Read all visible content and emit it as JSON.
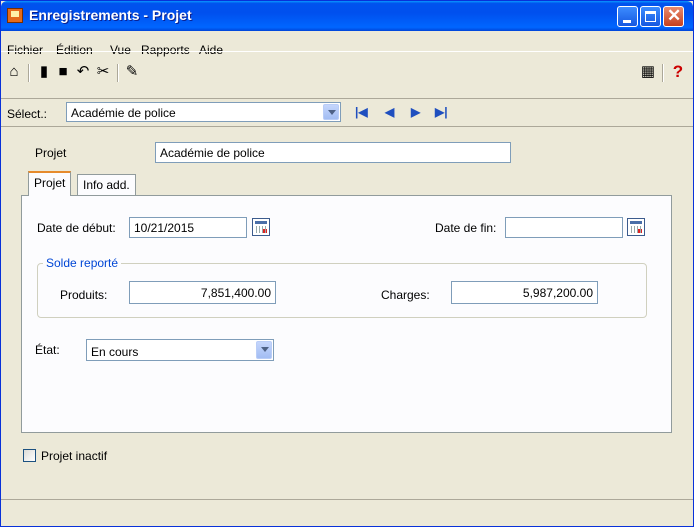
{
  "window": {
    "title": "Enregistrements - Projet"
  },
  "menu": [
    "Fichier",
    "Édition",
    "Vue",
    "Rapports",
    "Aide"
  ],
  "toolbar": {
    "help_label": "?"
  },
  "selector": {
    "label": "Sélect.:",
    "value": "Académie de police"
  },
  "form": {
    "projet_label": "Projet",
    "projet_value": "Académie de police",
    "tabs": [
      "Projet",
      "Info add."
    ],
    "date_debut_label": "Date de début:",
    "date_debut_value": "10/21/2015",
    "date_fin_label": "Date de fin:",
    "date_fin_value": "",
    "solde_group_title": "Solde reporté",
    "produits_label": "Produits:",
    "produits_value": "7,851,400.00",
    "charges_label": "Charges:",
    "charges_value": "5,987,200.00",
    "etat_label": "État:",
    "etat_value": "En cours",
    "inactif_label": "Projet inactif"
  },
  "colors": {
    "title_bar": "#0053ee",
    "window_bg": "#ece9d8",
    "panel_bg": "#fcfcfe",
    "group_title": "#0046d5",
    "help_icon": "#cc0000"
  }
}
